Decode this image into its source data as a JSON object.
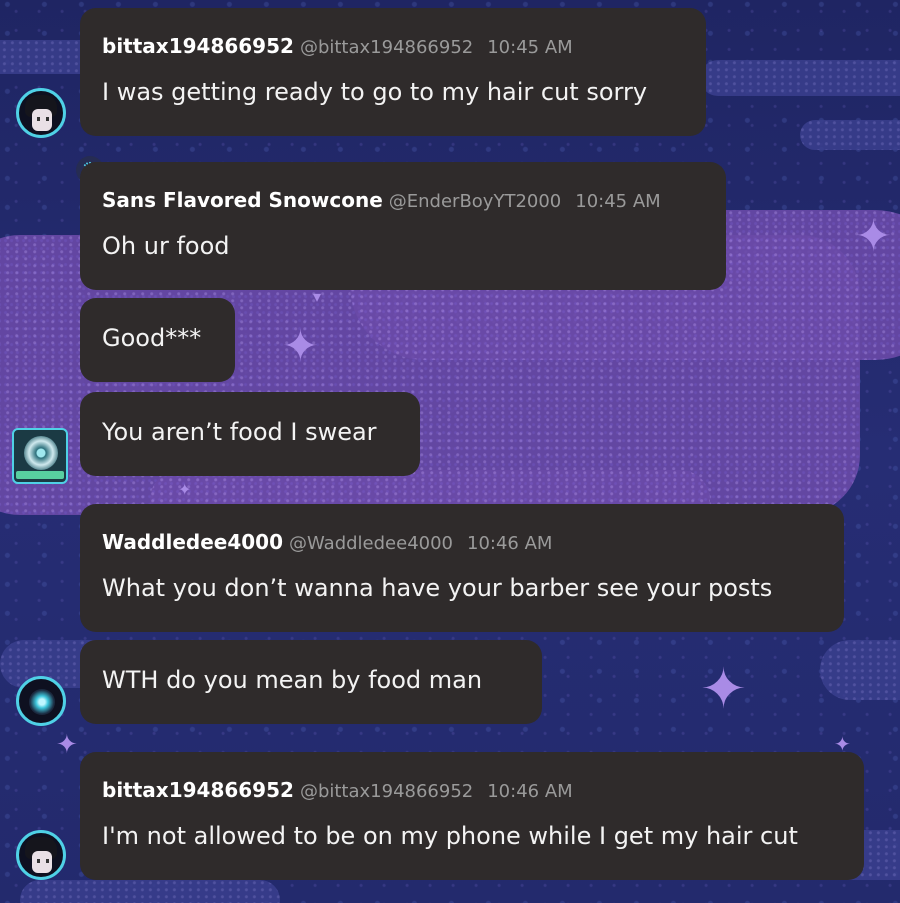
{
  "messages": [
    {
      "username": "bittax194866952",
      "handle": "@bittax194866952",
      "time": "10:45 AM",
      "text": "I was getting ready to go to my hair cut sorry"
    },
    {
      "username": "Sans Flavored Snowcone",
      "handle": "@EnderBoyYT2000",
      "time": "10:45 AM",
      "text": "Oh ur food"
    },
    {
      "text": "Good***"
    },
    {
      "text": "You aren’t food I swear"
    },
    {
      "username": "Waddledee4000",
      "handle": "@Waddledee4000",
      "time": "10:46 AM",
      "text": "What you don’t wanna have your barber see your posts"
    },
    {
      "text": "WTH do you mean by food man"
    },
    {
      "username": "bittax194866952",
      "handle": "@bittax194866952",
      "time": "10:46 AM",
      "text": "I'm not allowed to be on my phone while I get my hair cut"
    }
  ],
  "icons": {
    "crown": "crown-icon",
    "sparkle": "sparkle-icon"
  },
  "colors": {
    "bubble": "#2f2b2b",
    "background": "#232a6e",
    "accent": "#4fd1e6",
    "cloud": "#6a4aa8"
  }
}
